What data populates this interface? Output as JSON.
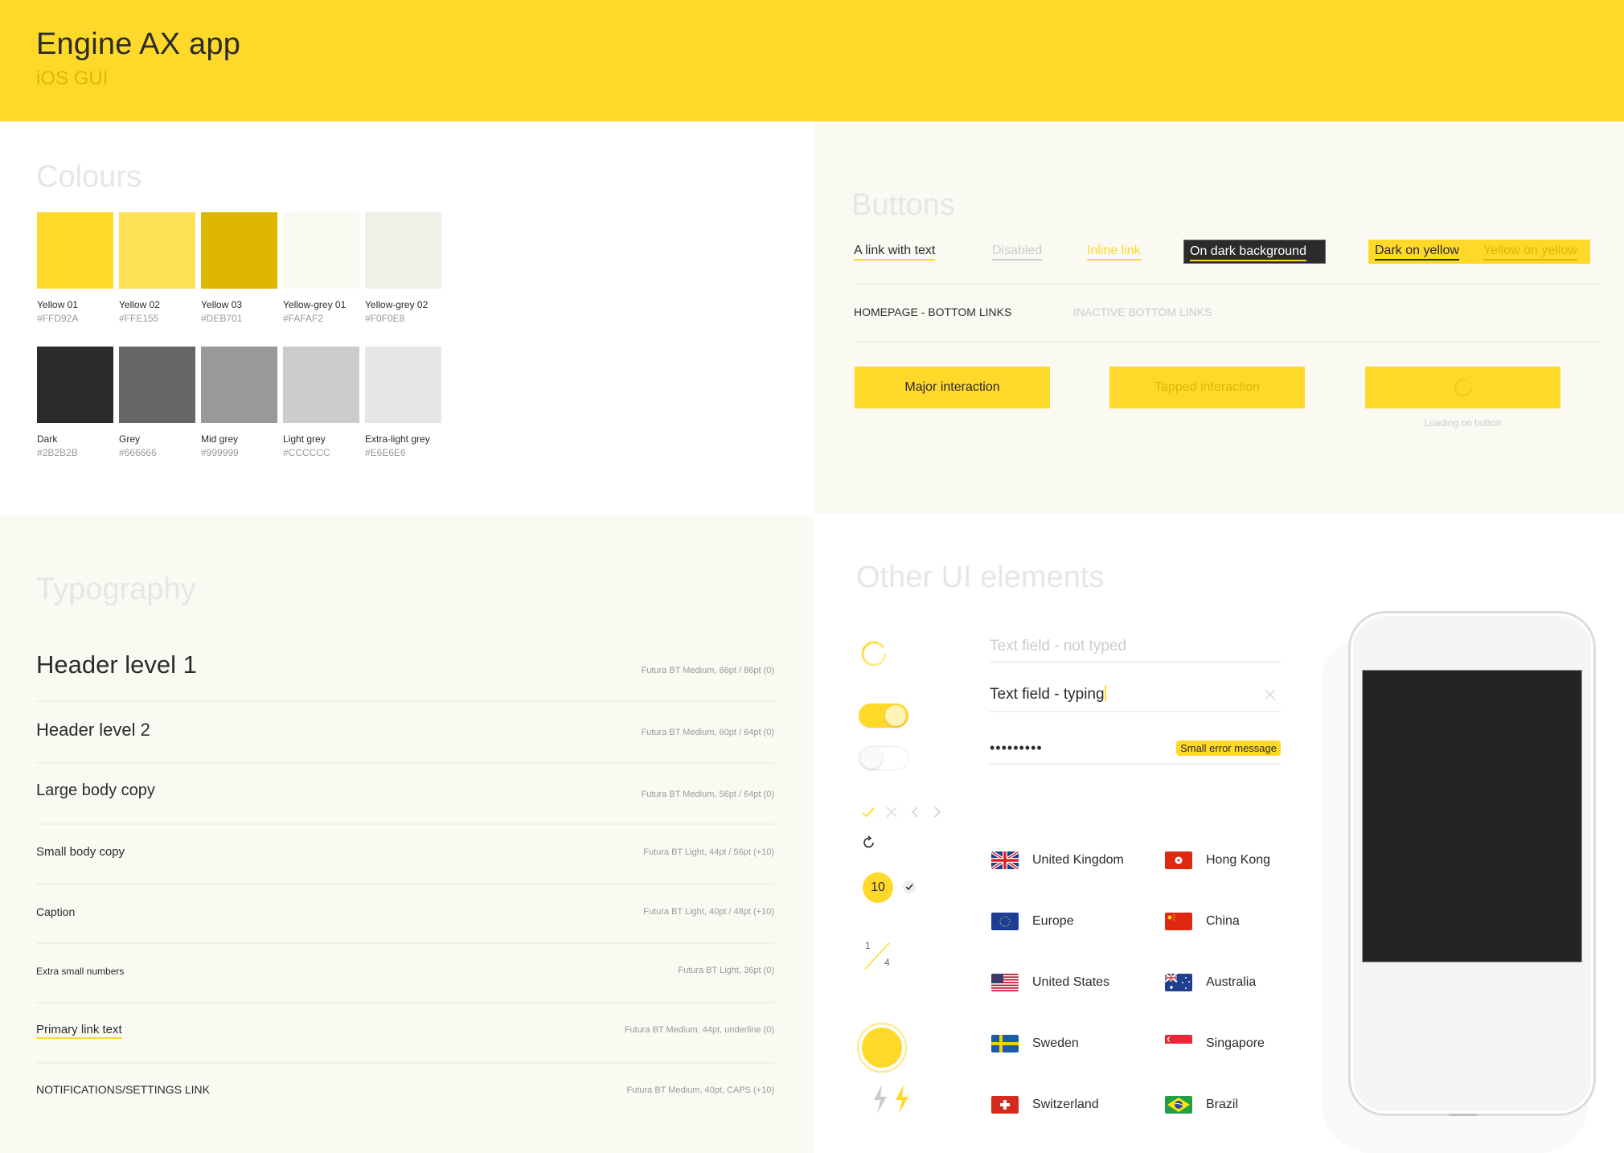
{
  "header": {
    "title": "Engine AX app",
    "subtitle": "iOS GUI",
    "background": "#FFD92A"
  },
  "colours": {
    "title": "Colours",
    "swatches": [
      {
        "name": "Yellow 01",
        "hex": "#FFD92A"
      },
      {
        "name": "Yellow 02",
        "hex": "#FFE155"
      },
      {
        "name": "Yellow 03",
        "hex": "#DEB701"
      },
      {
        "name": "Yellow-grey 01",
        "hex": "#FAFAF2"
      },
      {
        "name": "Yellow-grey 02",
        "hex": "#F0F0E8"
      },
      {
        "name": "Dark",
        "hex": "#2B2B2B"
      },
      {
        "name": "Grey",
        "hex": "#666666"
      },
      {
        "name": "Mid grey",
        "hex": "#999999"
      },
      {
        "name": "Light grey",
        "hex": "#CCCCCC"
      },
      {
        "name": "Extra-light grey",
        "hex": "#E6E6E6"
      }
    ]
  },
  "buttons": {
    "title": "Buttons",
    "links": {
      "link_with_text": "A link with text",
      "disabled": "Disabled",
      "inline_link": "Inline link",
      "on_dark": "On dark background",
      "dark_on_yellow": "Dark on yellow",
      "yellow_on_yellow": "Yellow on yellow"
    },
    "bottom_links": {
      "active": "HOMEPAGE - BOTTOM LINKS",
      "inactive": "INACTIVE BOTTOM LINKS"
    },
    "major": "Major interaction",
    "tapped": "Tapped interaction",
    "loading_caption": "Loading on button"
  },
  "typography": {
    "title": "Typography",
    "rows": [
      {
        "sample": "Header level 1",
        "meta": "Futura BT Medium, 86pt / 86pt (0)"
      },
      {
        "sample": "Header level 2",
        "meta": "Futura BT Medium, 60pt / 64pt (0)"
      },
      {
        "sample": "Large body copy",
        "meta": "Futura BT Medium, 56pt / 64pt (0)"
      },
      {
        "sample": "Small body copy",
        "meta": "Futura BT Light, 44pt / 56pt (+10)"
      },
      {
        "sample": "Caption",
        "meta": "Futura BT Light, 40pt / 48pt (+10)"
      },
      {
        "sample": "Extra small numbers",
        "meta": "Futura BT Light, 36pt (0)"
      },
      {
        "sample": "Primary link text",
        "meta": "Futura BT Medium, 44pt, underline (0)"
      },
      {
        "sample": "NOTIFICATIONS/SETTINGS LINK",
        "meta": "Futura BT Medium, 40pt, CAPS (+10)"
      }
    ]
  },
  "other": {
    "title": "Other UI elements",
    "text_field_placeholder": "Text field - not typed",
    "text_field_typing": "Text field - typing",
    "password_value": "•••••••••",
    "error_message": "Small error message",
    "toggle_on": true,
    "toggle_off": false,
    "badge_number": "10",
    "fraction": {
      "numerator": "1",
      "denominator": "4"
    },
    "icons": [
      "check-icon",
      "close-icon",
      "chevron-left-icon",
      "chevron-right-icon",
      "refresh-icon",
      "small-check-icon",
      "sun-icon",
      "bolt-grey-icon",
      "bolt-yellow-icon"
    ],
    "countries": [
      {
        "name": "United Kingdom",
        "flag": "uk"
      },
      {
        "name": "Hong Kong",
        "flag": "hk"
      },
      {
        "name": "Europe",
        "flag": "eu"
      },
      {
        "name": "China",
        "flag": "cn"
      },
      {
        "name": "United States",
        "flag": "us"
      },
      {
        "name": "Australia",
        "flag": "au"
      },
      {
        "name": "Sweden",
        "flag": "se"
      },
      {
        "name": "Singapore",
        "flag": "sg"
      },
      {
        "name": "Switzerland",
        "flag": "ch"
      },
      {
        "name": "Brazil",
        "flag": "br"
      }
    ]
  }
}
